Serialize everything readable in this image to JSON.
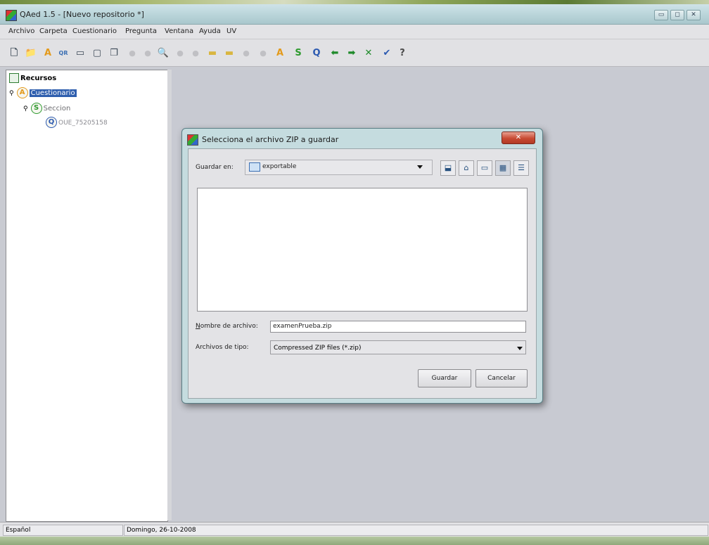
{
  "window": {
    "title": "QAed 1.5 - [Nuevo repositorio *]",
    "controls": [
      "▭",
      "◻",
      "✕"
    ]
  },
  "menubar": {
    "items": [
      "Archivo",
      "Carpeta",
      "Cuestionario",
      "Pregunta",
      "Ventana",
      "Ayuda",
      "UV"
    ]
  },
  "toolbar": {
    "buttons": [
      {
        "name": "new-icon",
        "glyph": "🗋",
        "color": "#44515e",
        "enabled": true
      },
      {
        "name": "open-folder-icon",
        "glyph": "📁",
        "color": "#c8a62a",
        "enabled": true
      },
      {
        "name": "a-icon",
        "glyph": "A",
        "color": "#e39a1c",
        "enabled": true
      },
      {
        "name": "qr-icon",
        "glyph": "QR",
        "color": "#3b6fb3",
        "enabled": true
      },
      {
        "name": "window-icon",
        "glyph": "▭",
        "color": "#3d4a57",
        "enabled": true
      },
      {
        "name": "save-icon",
        "glyph": "▢",
        "color": "#3d4a57",
        "enabled": true
      },
      {
        "name": "copy-icon",
        "glyph": "❐",
        "color": "#3d4a57",
        "enabled": true
      },
      {
        "name": "disabled-icon-1",
        "glyph": "●",
        "color": "#c0c0c4",
        "enabled": false
      },
      {
        "name": "disabled-icon-2",
        "glyph": "●",
        "color": "#c0c0c4",
        "enabled": false
      },
      {
        "name": "search-icon",
        "glyph": "🔍",
        "color": "#6c7a88",
        "enabled": true
      },
      {
        "name": "disabled-icon-3",
        "glyph": "●",
        "color": "#c0c0c4",
        "enabled": false
      },
      {
        "name": "disabled-icon-4",
        "glyph": "●",
        "color": "#c0c0c4",
        "enabled": false
      },
      {
        "name": "folder-up-icon",
        "glyph": "▬",
        "color": "#d9b640",
        "enabled": true
      },
      {
        "name": "folder-down-icon",
        "glyph": "▬",
        "color": "#d9b640",
        "enabled": true
      },
      {
        "name": "disabled-icon-5",
        "glyph": "●",
        "color": "#c0c0c4",
        "enabled": false
      },
      {
        "name": "disabled-icon-6",
        "glyph": "●",
        "color": "#c0c0c4",
        "enabled": false
      },
      {
        "name": "add-a-icon",
        "glyph": "A",
        "color": "#e39a1c",
        "enabled": true
      },
      {
        "name": "add-s-icon",
        "glyph": "S",
        "color": "#2e9a2e",
        "enabled": true
      },
      {
        "name": "add-q-icon",
        "glyph": "Q",
        "color": "#2b59b0",
        "enabled": true
      },
      {
        "name": "arrow-left-icon",
        "glyph": "⬅",
        "color": "#1e8a2a",
        "enabled": true
      },
      {
        "name": "arrow-right-icon",
        "glyph": "➡",
        "color": "#1e8a2a",
        "enabled": true
      },
      {
        "name": "delete-icon",
        "glyph": "✕",
        "color": "#1e8a2a",
        "enabled": true
      },
      {
        "name": "check-icon",
        "glyph": "✔",
        "color": "#2b59b0",
        "enabled": true
      },
      {
        "name": "help-icon",
        "glyph": "?",
        "color": "#4a4a4a",
        "enabled": true
      }
    ]
  },
  "tree": {
    "root": "Recursos",
    "cuestionario": "Cuestionario",
    "seccion": "Seccion",
    "pregunta": "OUE_75205158",
    "icons": {
      "cuestionario": "A",
      "seccion": "S",
      "pregunta": "Q"
    },
    "colors": {
      "a": "#e39a1c",
      "s": "#2e9a2e",
      "q": "#2b59b0",
      "selection": "#2f5fae"
    }
  },
  "statusbar": {
    "language": "Español",
    "date": "Domingo, 26-10-2008"
  },
  "dialog": {
    "title": "Selecciona el archivo ZIP a guardar",
    "close": "✕",
    "save_in_label": "Guardar en:",
    "location": "exportable",
    "filename_label": "Nombre de archivo:",
    "filename_value": "examenPrueba.zip",
    "filetype_label": "Archivos de tipo:",
    "filetype_value": "Compressed ZIP files (*.zip)",
    "save_button": "Guardar",
    "cancel_button": "Cancelar"
  }
}
